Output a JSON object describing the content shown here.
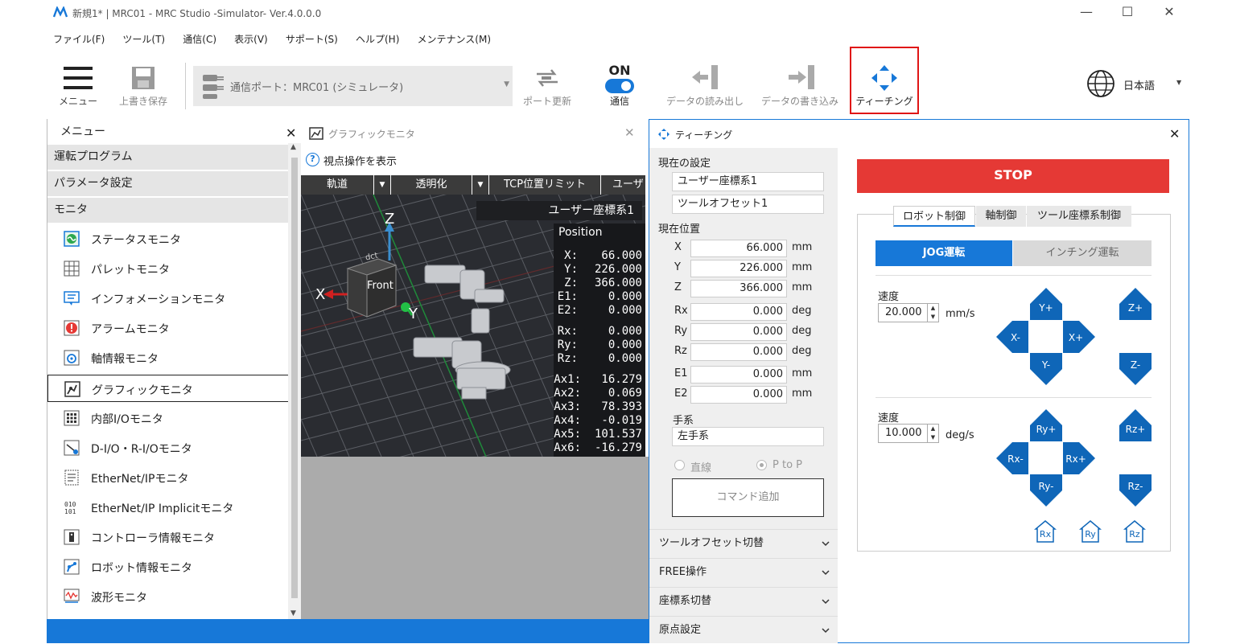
{
  "window": {
    "title": "新規1* | MRC01 - MRC Studio -Simulator- Ver.4.0.0.0"
  },
  "menubar": [
    "ファイル(F)",
    "ツール(T)",
    "通信(C)",
    "表示(V)",
    "サポート(S)",
    "ヘルプ(H)",
    "メンテナンス(M)"
  ],
  "toolbar": {
    "menu": "メニュー",
    "save": "上書き保存",
    "port": "通信ポート：MRC01 (シミュレータ)",
    "port_refresh": "ポート更新",
    "comm_state": "ON",
    "comm": "通信",
    "data_read": "データの読み出し",
    "data_write": "データの書き込み",
    "teaching": "ティーチング",
    "language": "日本語"
  },
  "left_panel": {
    "title": "メニュー",
    "categories": [
      "運転プログラム",
      "パラメータ設定",
      "モニタ"
    ],
    "items": [
      "ステータスモニタ",
      "パレットモニタ",
      "インフォメーションモニタ",
      "アラームモニタ",
      "軸情報モニタ",
      "グラフィックモニタ",
      "内部I/Oモニタ",
      "D-I/O・R-I/Oモニタ",
      "EtherNet/IPモニタ",
      "EtherNet/IP Implicitモニタ",
      "コントローラ情報モニタ",
      "ロボット情報モニタ",
      "波形モニタ"
    ]
  },
  "graphic_monitor": {
    "title": "グラフィックモニタ",
    "viewpoint": "視点操作を表示",
    "buttons": [
      "軌道",
      "透明化",
      "TCP位置リミット",
      "ユーザ"
    ],
    "coord_label": "ユーザー座標系1",
    "position_title": "Position",
    "axes_labels": {
      "x": "X",
      "y": "Y",
      "z": "Z"
    },
    "cube_label": "Front",
    "cube_top": "dct",
    "position": [
      {
        "k": "X:",
        "v": "66.000"
      },
      {
        "k": "Y:",
        "v": "226.000"
      },
      {
        "k": "Z:",
        "v": "366.000"
      },
      {
        "k": "E1:",
        "v": "0.000"
      },
      {
        "k": "E2:",
        "v": "0.000"
      },
      {
        "k": "Rx:",
        "v": "0.000"
      },
      {
        "k": "Ry:",
        "v": "0.000"
      },
      {
        "k": "Rz:",
        "v": "0.000"
      },
      {
        "k": "Ax1:",
        "v": "16.279"
      },
      {
        "k": "Ax2:",
        "v": "0.069"
      },
      {
        "k": "Ax3:",
        "v": "78.393"
      },
      {
        "k": "Ax4:",
        "v": "-0.019"
      },
      {
        "k": "Ax5:",
        "v": "101.537"
      },
      {
        "k": "Ax6:",
        "v": "-16.279"
      }
    ]
  },
  "teaching": {
    "title": "ティーチング",
    "current_settings": "現在の設定",
    "user_coord": "ユーザー座標系1",
    "tool_offset": "ツールオフセット1",
    "current_position": "現在位置",
    "rows": [
      {
        "axis": "X",
        "value": "66.000",
        "unit": "mm"
      },
      {
        "axis": "Y",
        "value": "226.000",
        "unit": "mm"
      },
      {
        "axis": "Z",
        "value": "366.000",
        "unit": "mm"
      },
      {
        "axis": "Rx",
        "value": "0.000",
        "unit": "deg"
      },
      {
        "axis": "Ry",
        "value": "0.000",
        "unit": "deg"
      },
      {
        "axis": "Rz",
        "value": "0.000",
        "unit": "deg"
      },
      {
        "axis": "E1",
        "value": "0.000",
        "unit": "mm"
      },
      {
        "axis": "E2",
        "value": "0.000",
        "unit": "mm"
      }
    ],
    "hand_system_label": "手系",
    "hand_system": "左手系",
    "radio_linear": "直線",
    "radio_ptp": "P to P",
    "add_command": "コマンド追加",
    "accordions": [
      "ツールオフセット切替",
      "FREE操作",
      "座標系切替",
      "原点設定"
    ],
    "stop": "STOP",
    "tabs": [
      "ロボット制御",
      "軸制御",
      "ツール座標系制御"
    ],
    "mode_jog": "JOG運転",
    "mode_inching": "インチング運転",
    "speed_label": "速度",
    "speed1": "20.000",
    "speed1_unit": "mm/s",
    "speed2": "10.000",
    "speed2_unit": "deg/s",
    "jog_linear": [
      "Y+",
      "X-",
      "X+",
      "Y-",
      "Z+",
      "Z-"
    ],
    "jog_rot": [
      "Ry+",
      "Rx-",
      "Rx+",
      "Ry-",
      "Rz+",
      "Rz-"
    ],
    "home_buttons": [
      "Rx",
      "Ry",
      "Rz"
    ]
  },
  "colors": {
    "accent": "#1778d8",
    "stop": "#e53935",
    "jog_blue": "#0f66b8",
    "highlight": "#e01515"
  }
}
